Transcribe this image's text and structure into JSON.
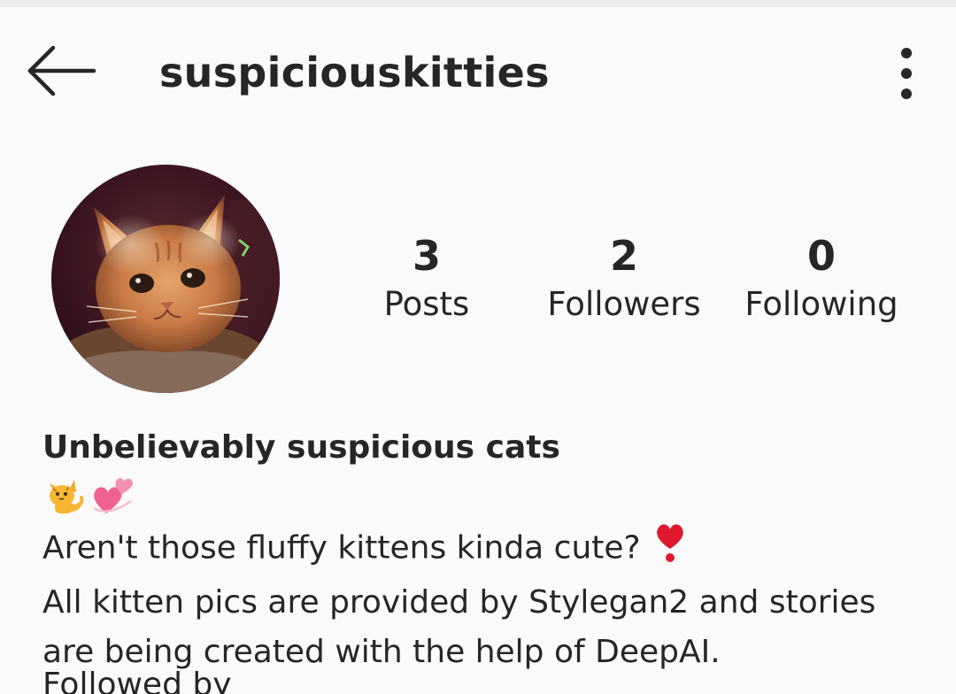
{
  "header": {
    "username": "suspiciouskitties",
    "back_icon": "arrow-left-icon",
    "more_icon": "vertical-dots-icon"
  },
  "profile": {
    "avatar_description": "profile-photo",
    "stats": [
      {
        "value": "3",
        "label": "Posts"
      },
      {
        "value": "2",
        "label": "Followers"
      },
      {
        "value": "0",
        "label": "Following"
      }
    ]
  },
  "bio": {
    "name": "Unbelievably suspicious cats",
    "emojis": [
      "cat-face-emoji",
      "two-hearts-emoji"
    ],
    "line1": "Aren't those fluffy kittens kinda cute?",
    "line1_emoji": "heavy-heart-exclamation-emoji",
    "line2": "All kitten pics are provided by Stylegan2 and stories",
    "line3": "are being created with the help of DeepAI.",
    "line4_partial": "Followed by"
  },
  "colors": {
    "background": "#fafafa",
    "text": "#262626",
    "heart": "#e0182d"
  }
}
